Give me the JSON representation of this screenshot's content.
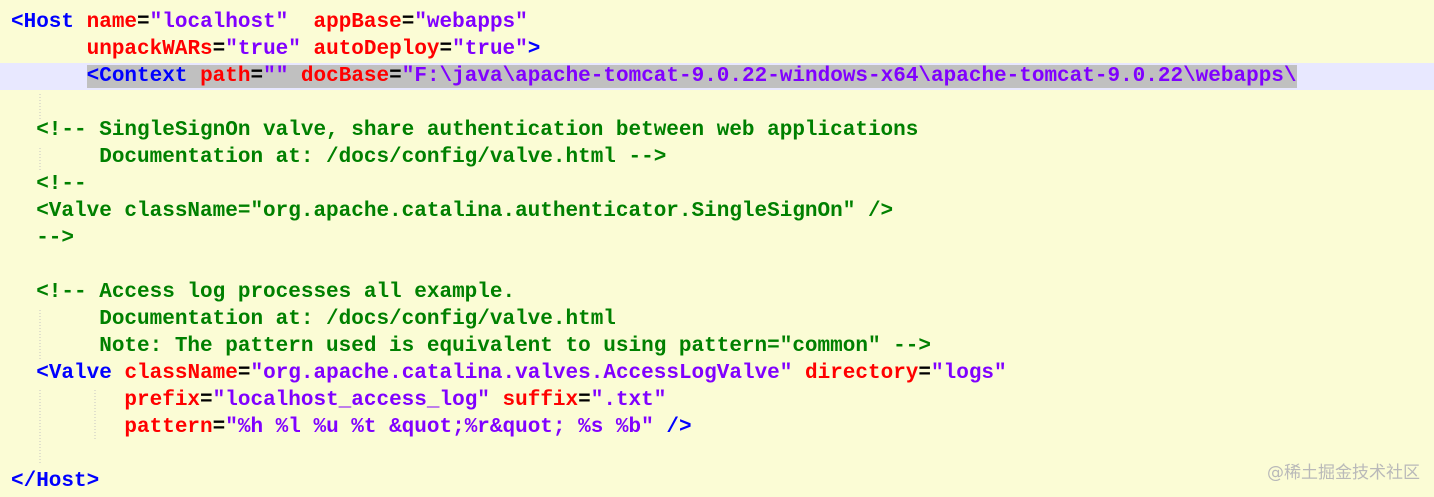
{
  "editor": {
    "lines": [
      {
        "current": false,
        "tokens": [
          {
            "t": "<Host",
            "c": "tag"
          },
          {
            "t": " ",
            "c": "eq"
          },
          {
            "t": "name",
            "c": "attr"
          },
          {
            "t": "=",
            "c": "eq"
          },
          {
            "t": "\"localhost\"",
            "c": "val"
          },
          {
            "t": "  ",
            "c": "eq"
          },
          {
            "t": "appBase",
            "c": "attr"
          },
          {
            "t": "=",
            "c": "eq"
          },
          {
            "t": "\"webapps\"",
            "c": "val"
          }
        ]
      },
      {
        "current": false,
        "tokens": [
          {
            "t": "      ",
            "c": "eq"
          },
          {
            "t": "unpackWARs",
            "c": "attr"
          },
          {
            "t": "=",
            "c": "eq"
          },
          {
            "t": "\"true\"",
            "c": "val"
          },
          {
            "t": " ",
            "c": "eq"
          },
          {
            "t": "autoDeploy",
            "c": "attr"
          },
          {
            "t": "=",
            "c": "eq"
          },
          {
            "t": "\"true\"",
            "c": "val"
          },
          {
            "t": ">",
            "c": "tag"
          }
        ]
      },
      {
        "current": true,
        "tokens": [
          {
            "t": "      ",
            "c": "eq"
          },
          {
            "t": "<Context",
            "c": "tag",
            "sel": true
          },
          {
            "t": " ",
            "c": "eq",
            "sel": true
          },
          {
            "t": "path",
            "c": "attr",
            "sel": true
          },
          {
            "t": "=",
            "c": "eq",
            "sel": true
          },
          {
            "t": "\"\"",
            "c": "val",
            "sel": true
          },
          {
            "t": " ",
            "c": "eq",
            "sel": true
          },
          {
            "t": "docBase",
            "c": "attr",
            "sel": true
          },
          {
            "t": "=",
            "c": "eq",
            "sel": true
          },
          {
            "t": "\"F:\\java\\apache-tomcat-9.0.22-windows-x64\\apache-tomcat-9.0.22\\webapps\\",
            "c": "val",
            "sel": true
          }
        ]
      },
      {
        "current": false,
        "tokens": []
      },
      {
        "current": false,
        "tokens": [
          {
            "t": "  <!-- SingleSignOn valve, share authentication between web applications",
            "c": "comment"
          }
        ]
      },
      {
        "current": false,
        "tokens": [
          {
            "t": "       Documentation at: /docs/config/valve.html -->",
            "c": "comment"
          }
        ]
      },
      {
        "current": false,
        "tokens": [
          {
            "t": "  <!--",
            "c": "comment"
          }
        ]
      },
      {
        "current": false,
        "tokens": [
          {
            "t": "  <Valve className=\"org.apache.catalina.authenticator.SingleSignOn\" />",
            "c": "comment"
          }
        ]
      },
      {
        "current": false,
        "tokens": [
          {
            "t": "  -->",
            "c": "comment"
          }
        ]
      },
      {
        "current": false,
        "tokens": []
      },
      {
        "current": false,
        "tokens": [
          {
            "t": "  <!-- Access log processes all example.",
            "c": "comment"
          }
        ]
      },
      {
        "current": false,
        "tokens": [
          {
            "t": "       Documentation at: /docs/config/valve.html",
            "c": "comment"
          }
        ]
      },
      {
        "current": false,
        "tokens": [
          {
            "t": "       Note: The pattern used is equivalent to using pattern=\"common\" -->",
            "c": "comment"
          }
        ]
      },
      {
        "current": false,
        "tokens": [
          {
            "t": "  ",
            "c": "eq"
          },
          {
            "t": "<Valve",
            "c": "tag"
          },
          {
            "t": " ",
            "c": "eq"
          },
          {
            "t": "className",
            "c": "attr"
          },
          {
            "t": "=",
            "c": "eq"
          },
          {
            "t": "\"org.apache.catalina.valves.AccessLogValve\"",
            "c": "val"
          },
          {
            "t": " ",
            "c": "eq"
          },
          {
            "t": "directory",
            "c": "attr"
          },
          {
            "t": "=",
            "c": "eq"
          },
          {
            "t": "\"logs\"",
            "c": "val"
          }
        ]
      },
      {
        "current": false,
        "tokens": [
          {
            "t": "         ",
            "c": "eq"
          },
          {
            "t": "prefix",
            "c": "attr"
          },
          {
            "t": "=",
            "c": "eq"
          },
          {
            "t": "\"localhost_access_log\"",
            "c": "val"
          },
          {
            "t": " ",
            "c": "eq"
          },
          {
            "t": "suffix",
            "c": "attr"
          },
          {
            "t": "=",
            "c": "eq"
          },
          {
            "t": "\".txt\"",
            "c": "val"
          }
        ]
      },
      {
        "current": false,
        "tokens": [
          {
            "t": "         ",
            "c": "eq"
          },
          {
            "t": "pattern",
            "c": "attr"
          },
          {
            "t": "=",
            "c": "eq"
          },
          {
            "t": "\"%h %l %u %t &quot;%r&quot; %s %b\"",
            "c": "val"
          },
          {
            "t": " ",
            "c": "eq"
          },
          {
            "t": "/>",
            "c": "tag"
          }
        ]
      },
      {
        "current": false,
        "tokens": []
      },
      {
        "current": false,
        "tokens": [
          {
            "t": "</Host>",
            "c": "tag"
          }
        ]
      }
    ]
  },
  "colors": {
    "background": "#fbfcd5",
    "current_line": "#e8e8ff",
    "selection": "#c0c0c0",
    "tag": "#0000ff",
    "attribute": "#ff0000",
    "value": "#8000ff",
    "comment": "#008000"
  },
  "watermark": {
    "text": "@稀土掘金技术社区"
  }
}
